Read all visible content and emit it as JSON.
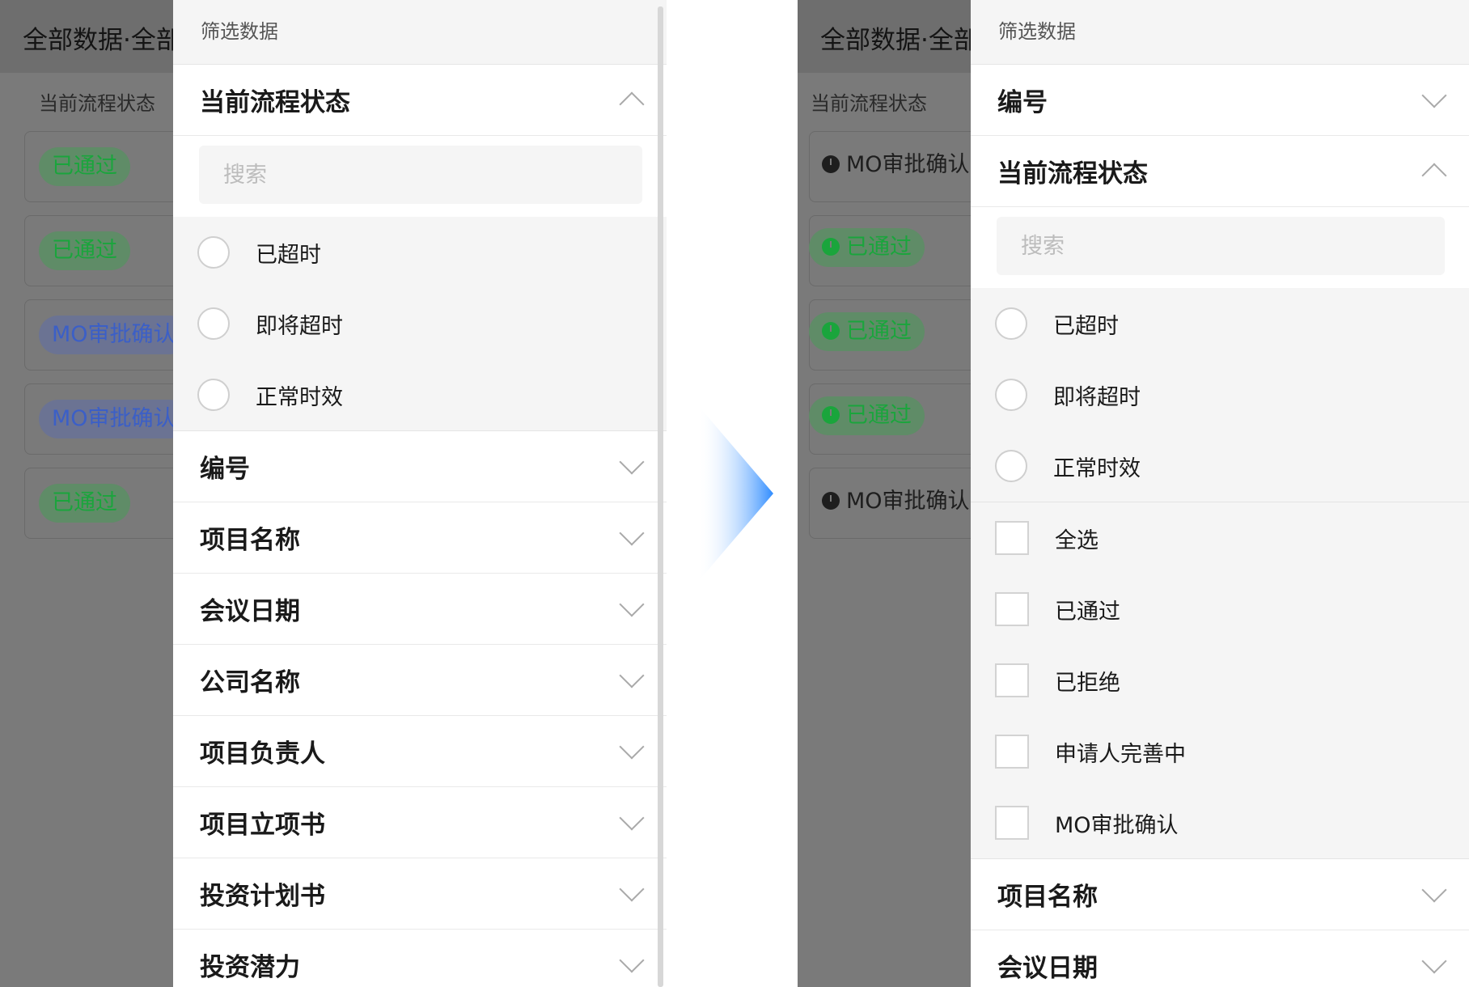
{
  "left": {
    "background": {
      "title": "全部数据·全部",
      "column_header": "当前流程状态",
      "rows": [
        "已通过",
        "已通过",
        "MO审批确认",
        "MO审批确认",
        "已通过"
      ]
    },
    "panel": {
      "title": "筛选数据",
      "expanded_section": "当前流程状态",
      "search_placeholder": "搜索",
      "time_options": [
        "已超时",
        "即将超时",
        "正常时效"
      ],
      "sections": [
        "编号",
        "项目名称",
        "会议日期",
        "公司名称",
        "项目负责人",
        "项目立项书",
        "投资计划书",
        "投资潜力"
      ]
    }
  },
  "right": {
    "background": {
      "title": "全部数据·全部",
      "column_header": "当前流程状态",
      "rows": [
        "MO审批确认",
        "已通过",
        "已通过",
        "已通过",
        "MO审批确认"
      ]
    },
    "panel": {
      "title": "筛选数据",
      "section_top": "编号",
      "expanded_section": "当前流程状态",
      "search_placeholder": "搜索",
      "time_options": [
        "已超时",
        "即将超时",
        "正常时效"
      ],
      "status_options": [
        "全选",
        "已通过",
        "已拒绝",
        "申请人完善中",
        "MO审批确认"
      ],
      "sections": [
        "项目名称",
        "会议日期"
      ]
    }
  },
  "colors": {
    "approved_text": "#1aa53c",
    "mo_text": "#3b5fc7",
    "arrow_blue": "#2f8cff"
  }
}
